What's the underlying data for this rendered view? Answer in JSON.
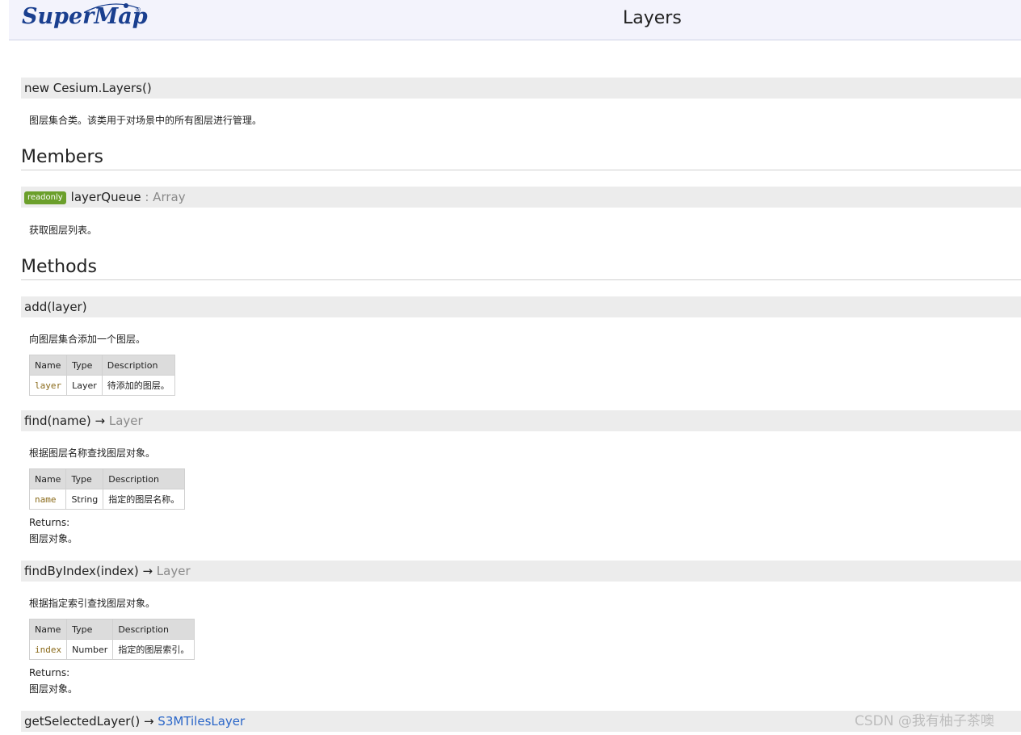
{
  "header": {
    "logo_text": "SuperMap",
    "logo_reg": "®",
    "title": "Layers"
  },
  "constructor": {
    "signature": "new Cesium.Layers()",
    "description": "图层集合类。该类用于对场景中的所有图层进行管理。"
  },
  "members": {
    "title": "Members",
    "items": [
      {
        "badge": "readonly",
        "name": "layerQueue",
        "type": " : Array",
        "description": "获取图层列表。"
      }
    ]
  },
  "methods": {
    "title": "Methods",
    "items": [
      {
        "signature": "add(layer)",
        "arrow": "",
        "return_type": "",
        "description": "向图层集合添加一个图层。",
        "params_headers": [
          "Name",
          "Type",
          "Description"
        ],
        "params": [
          {
            "name": "layer",
            "type": "Layer",
            "description": "待添加的图层。"
          }
        ],
        "returns_label": "",
        "returns_text": ""
      },
      {
        "signature": "find(name)",
        "arrow": " → ",
        "return_type": "Layer",
        "description": "根据图层名称查找图层对象。",
        "params_headers": [
          "Name",
          "Type",
          "Description"
        ],
        "params": [
          {
            "name": "name",
            "type": "String",
            "description": "指定的图层名称。"
          }
        ],
        "returns_label": "Returns:",
        "returns_text": "图层对象。"
      },
      {
        "signature": "findByIndex(index)",
        "arrow": " → ",
        "return_type": "Layer",
        "description": "根据指定索引查找图层对象。",
        "params_headers": [
          "Name",
          "Type",
          "Description"
        ],
        "params": [
          {
            "name": "index",
            "type": "Number",
            "description": "指定的图层索引。"
          }
        ],
        "returns_label": "Returns:",
        "returns_text": "图层对象。"
      },
      {
        "signature": "getSelectedLayer()",
        "arrow": " → ",
        "return_type": "S3MTilesLayer"
      }
    ]
  },
  "watermark": "CSDN @我有柚子茶噢",
  "colors": {
    "header_bg": "#f3f3fc",
    "logo_blue": "#1a3f8f",
    "signature_bg": "#ececec",
    "badge_green": "#6b9f2b",
    "link_blue": "#2a66c8",
    "param_name": "#8a6a1a"
  }
}
